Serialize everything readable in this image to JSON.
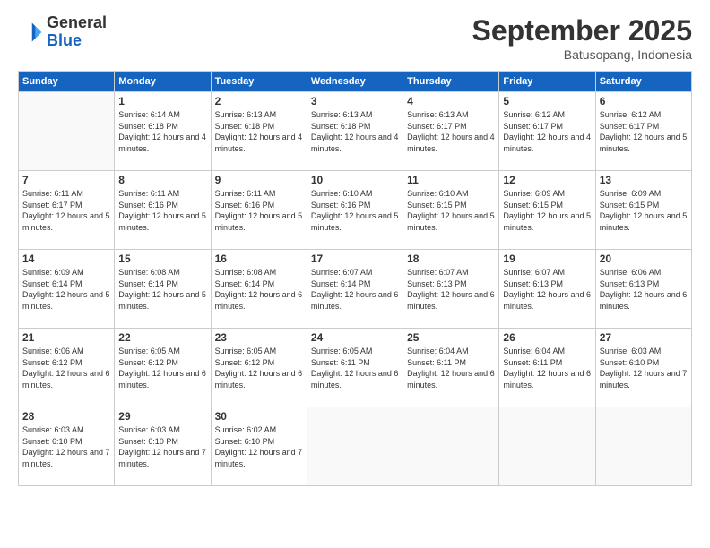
{
  "logo": {
    "general": "General",
    "blue": "Blue"
  },
  "header": {
    "month": "September 2025",
    "location": "Batusopang, Indonesia"
  },
  "days_of_week": [
    "Sunday",
    "Monday",
    "Tuesday",
    "Wednesday",
    "Thursday",
    "Friday",
    "Saturday"
  ],
  "weeks": [
    [
      {
        "day": "",
        "info": ""
      },
      {
        "day": "1",
        "info": "Sunrise: 6:14 AM\nSunset: 6:18 PM\nDaylight: 12 hours\nand 4 minutes."
      },
      {
        "day": "2",
        "info": "Sunrise: 6:13 AM\nSunset: 6:18 PM\nDaylight: 12 hours\nand 4 minutes."
      },
      {
        "day": "3",
        "info": "Sunrise: 6:13 AM\nSunset: 6:18 PM\nDaylight: 12 hours\nand 4 minutes."
      },
      {
        "day": "4",
        "info": "Sunrise: 6:13 AM\nSunset: 6:17 PM\nDaylight: 12 hours\nand 4 minutes."
      },
      {
        "day": "5",
        "info": "Sunrise: 6:12 AM\nSunset: 6:17 PM\nDaylight: 12 hours\nand 4 minutes."
      },
      {
        "day": "6",
        "info": "Sunrise: 6:12 AM\nSunset: 6:17 PM\nDaylight: 12 hours\nand 5 minutes."
      }
    ],
    [
      {
        "day": "7",
        "info": "Sunrise: 6:11 AM\nSunset: 6:17 PM\nDaylight: 12 hours\nand 5 minutes."
      },
      {
        "day": "8",
        "info": "Sunrise: 6:11 AM\nSunset: 6:16 PM\nDaylight: 12 hours\nand 5 minutes."
      },
      {
        "day": "9",
        "info": "Sunrise: 6:11 AM\nSunset: 6:16 PM\nDaylight: 12 hours\nand 5 minutes."
      },
      {
        "day": "10",
        "info": "Sunrise: 6:10 AM\nSunset: 6:16 PM\nDaylight: 12 hours\nand 5 minutes."
      },
      {
        "day": "11",
        "info": "Sunrise: 6:10 AM\nSunset: 6:15 PM\nDaylight: 12 hours\nand 5 minutes."
      },
      {
        "day": "12",
        "info": "Sunrise: 6:09 AM\nSunset: 6:15 PM\nDaylight: 12 hours\nand 5 minutes."
      },
      {
        "day": "13",
        "info": "Sunrise: 6:09 AM\nSunset: 6:15 PM\nDaylight: 12 hours\nand 5 minutes."
      }
    ],
    [
      {
        "day": "14",
        "info": "Sunrise: 6:09 AM\nSunset: 6:14 PM\nDaylight: 12 hours\nand 5 minutes."
      },
      {
        "day": "15",
        "info": "Sunrise: 6:08 AM\nSunset: 6:14 PM\nDaylight: 12 hours\nand 5 minutes."
      },
      {
        "day": "16",
        "info": "Sunrise: 6:08 AM\nSunset: 6:14 PM\nDaylight: 12 hours\nand 6 minutes."
      },
      {
        "day": "17",
        "info": "Sunrise: 6:07 AM\nSunset: 6:14 PM\nDaylight: 12 hours\nand 6 minutes."
      },
      {
        "day": "18",
        "info": "Sunrise: 6:07 AM\nSunset: 6:13 PM\nDaylight: 12 hours\nand 6 minutes."
      },
      {
        "day": "19",
        "info": "Sunrise: 6:07 AM\nSunset: 6:13 PM\nDaylight: 12 hours\nand 6 minutes."
      },
      {
        "day": "20",
        "info": "Sunrise: 6:06 AM\nSunset: 6:13 PM\nDaylight: 12 hours\nand 6 minutes."
      }
    ],
    [
      {
        "day": "21",
        "info": "Sunrise: 6:06 AM\nSunset: 6:12 PM\nDaylight: 12 hours\nand 6 minutes."
      },
      {
        "day": "22",
        "info": "Sunrise: 6:05 AM\nSunset: 6:12 PM\nDaylight: 12 hours\nand 6 minutes."
      },
      {
        "day": "23",
        "info": "Sunrise: 6:05 AM\nSunset: 6:12 PM\nDaylight: 12 hours\nand 6 minutes."
      },
      {
        "day": "24",
        "info": "Sunrise: 6:05 AM\nSunset: 6:11 PM\nDaylight: 12 hours\nand 6 minutes."
      },
      {
        "day": "25",
        "info": "Sunrise: 6:04 AM\nSunset: 6:11 PM\nDaylight: 12 hours\nand 6 minutes."
      },
      {
        "day": "26",
        "info": "Sunrise: 6:04 AM\nSunset: 6:11 PM\nDaylight: 12 hours\nand 6 minutes."
      },
      {
        "day": "27",
        "info": "Sunrise: 6:03 AM\nSunset: 6:10 PM\nDaylight: 12 hours\nand 7 minutes."
      }
    ],
    [
      {
        "day": "28",
        "info": "Sunrise: 6:03 AM\nSunset: 6:10 PM\nDaylight: 12 hours\nand 7 minutes."
      },
      {
        "day": "29",
        "info": "Sunrise: 6:03 AM\nSunset: 6:10 PM\nDaylight: 12 hours\nand 7 minutes."
      },
      {
        "day": "30",
        "info": "Sunrise: 6:02 AM\nSunset: 6:10 PM\nDaylight: 12 hours\nand 7 minutes."
      },
      {
        "day": "",
        "info": ""
      },
      {
        "day": "",
        "info": ""
      },
      {
        "day": "",
        "info": ""
      },
      {
        "day": "",
        "info": ""
      }
    ]
  ]
}
